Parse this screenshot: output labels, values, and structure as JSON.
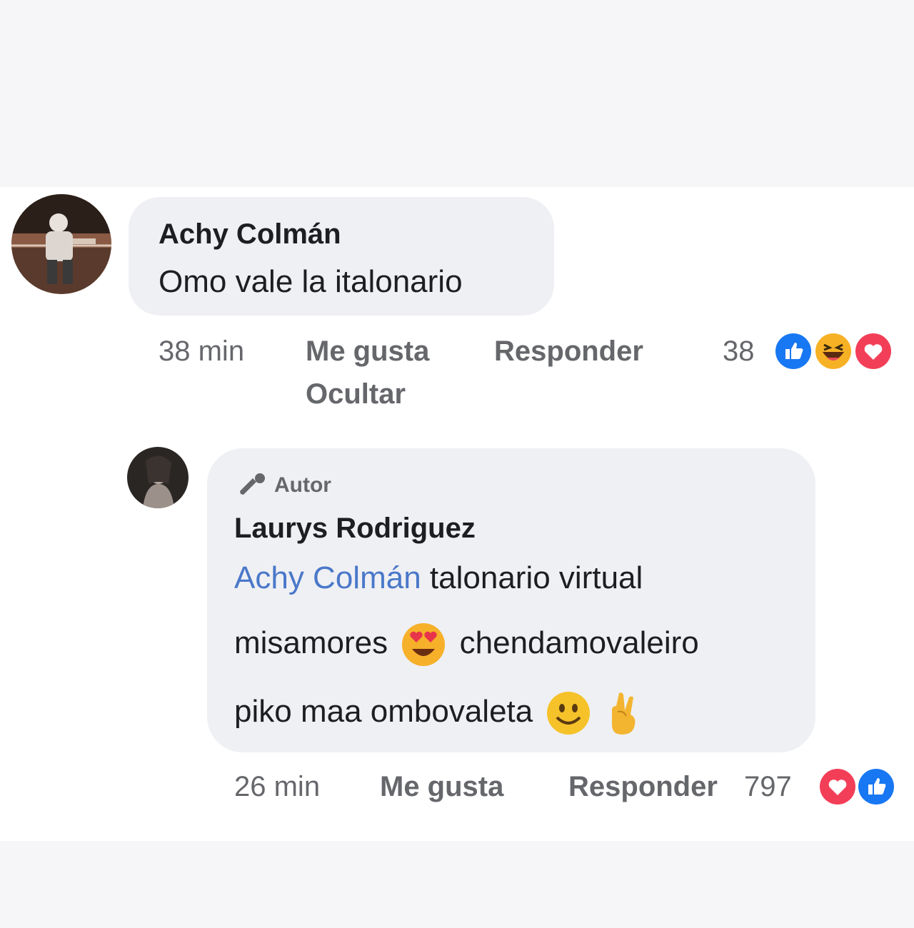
{
  "comment": {
    "author": "Achy Colmán",
    "text": "Omo vale la italonario",
    "time": "38 min",
    "like_label": "Me gusta",
    "reply_label": "Responder",
    "hide_label": "Ocultar",
    "reaction_count": "38",
    "reactions": [
      "like-icon",
      "haha-icon",
      "love-icon"
    ]
  },
  "reply": {
    "badge_label": "Autor",
    "author": "Laurys Rodriguez",
    "mention": "Achy Colmán",
    "line1_rest": "talonario virtual",
    "line2_a": "misamores",
    "line2_b": "chendamovaleiro",
    "line3": "piko maa ombovaleta",
    "emojis": [
      "heart-eyes-emoji",
      "smiley-emoji",
      "crossed-fingers-emoji"
    ],
    "time": "26 min",
    "like_label": "Me gusta",
    "reply_label": "Responder",
    "reaction_count": "797",
    "reactions": [
      "love-icon",
      "like-icon"
    ]
  },
  "colors": {
    "like_blue": "#1877f2",
    "love_red": "#f33e58",
    "haha_yellow": "#f7b125",
    "mention_blue": "#4a78c9",
    "bubble_bg": "#eff0f4"
  }
}
